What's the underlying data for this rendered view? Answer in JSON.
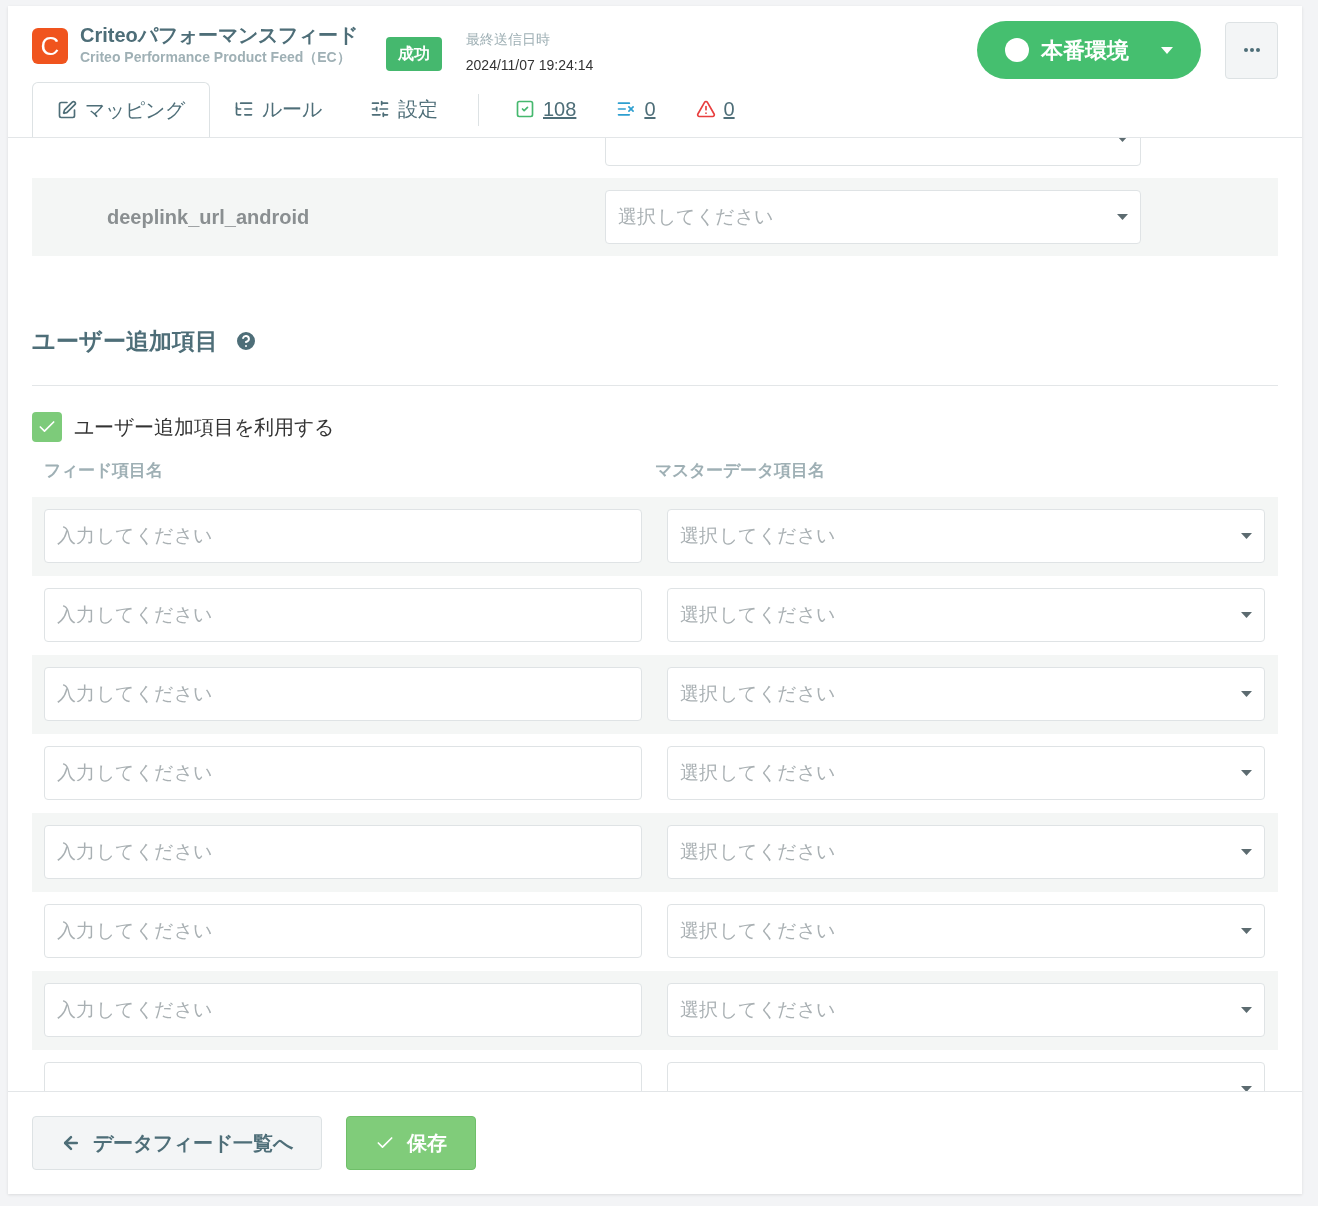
{
  "header": {
    "logo_letter": "C",
    "title": "Criteoパフォーマンスフィード",
    "subtitle": "Criteo Performance Product Feed（EC）",
    "status_badge": "成功",
    "last_sent_label": "最終送信日時",
    "last_sent_value": "2024/11/07 19:24:14",
    "environment": {
      "label": "本番環境",
      "on": true
    }
  },
  "tabs": [
    {
      "label": "マッピング",
      "kind": "mapping",
      "selected": true
    },
    {
      "label": "ルール",
      "kind": "rules",
      "selected": false
    },
    {
      "label": "設定",
      "kind": "settings",
      "selected": false
    }
  ],
  "counters": [
    {
      "kind": "valid",
      "value": "108"
    },
    {
      "kind": "excluded",
      "value": "0"
    },
    {
      "kind": "warning",
      "value": "0"
    }
  ],
  "mapping_rows": [
    {
      "kind": "partial"
    },
    {
      "kind": "full",
      "field": "deeplink_url_android",
      "placeholder": "選択してください"
    }
  ],
  "user_fields": {
    "title": "ユーザー追加項目",
    "use_checkbox": {
      "label": "ユーザー追加項目を利用する",
      "checked": true
    },
    "columns": [
      "フィード項目名",
      "マスターデータ項目名"
    ],
    "rows": [
      {
        "kind": "full",
        "input_placeholder": "入力してください",
        "select_placeholder": "選択してください"
      },
      {
        "kind": "full",
        "input_placeholder": "入力してください",
        "select_placeholder": "選択してください"
      },
      {
        "kind": "full",
        "input_placeholder": "入力してください",
        "select_placeholder": "選択してください"
      },
      {
        "kind": "full",
        "input_placeholder": "入力してください",
        "select_placeholder": "選択してください"
      },
      {
        "kind": "full",
        "input_placeholder": "入力してください",
        "select_placeholder": "選択してください"
      },
      {
        "kind": "full",
        "input_placeholder": "入力してください",
        "select_placeholder": "選択してください"
      },
      {
        "kind": "full",
        "input_placeholder": "入力してください",
        "select_placeholder": "選択してください"
      },
      {
        "kind": "partial"
      }
    ]
  },
  "footer": {
    "back_button": "データフィード一覧へ",
    "save_button": "保存"
  }
}
